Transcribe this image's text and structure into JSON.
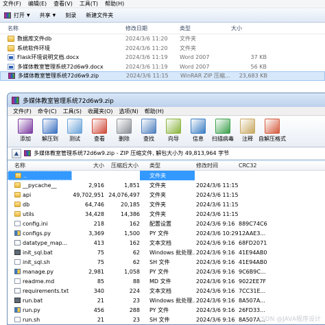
{
  "explorer": {
    "menu": [
      "文件(F)",
      "编辑(E)",
      "查看(V)",
      "工具(T)",
      "帮助(H)"
    ],
    "toolbar": {
      "open": "打开",
      "share": "共享",
      "burn": "刻录",
      "new_folder": "新建文件夹"
    },
    "columns": {
      "name": "名称",
      "date": "修改日期",
      "type": "类型",
      "size": "大小"
    },
    "rows": [
      {
        "name": "数据库文件db",
        "date": "2024/3/6 11:20",
        "type": "文件夹",
        "size": "",
        "icon": "folder-icon"
      },
      {
        "name": "系统软件环境",
        "date": "2024/3/6 11:20",
        "type": "文件夹",
        "size": "",
        "icon": "folder-icon"
      },
      {
        "name": "Flask环境说明文档.docx",
        "date": "2024/3/6 11:19",
        "type": "Word 2007",
        "size": "37 KB",
        "icon": "doc-icon"
      },
      {
        "name": "多媒体教室管理系统72d6w9.docx",
        "date": "2024/3/6 11:19",
        "type": "Word 2007",
        "size": "56 KB",
        "icon": "doc-icon"
      },
      {
        "name": "多媒体教室管理系统72d6w9.zip",
        "date": "2024/3/6 11:15",
        "type": "WinRAR ZIP 压缩...",
        "size": "23,683 KB",
        "icon": "zip-icon"
      }
    ]
  },
  "winrar": {
    "title": "多媒体教室管理系统72d6w9.zip",
    "menu": [
      "文件(F)",
      "命令(C)",
      "工具(S)",
      "收藏夹(O)",
      "选项(N)",
      "帮助(H)"
    ],
    "tools": [
      {
        "label": "添加",
        "icon": "add-icon",
        "color": "#7b3aa0"
      },
      {
        "label": "解压到",
        "icon": "extract-to-icon",
        "color": "#3a6fc1"
      },
      {
        "label": "测试",
        "icon": "test-icon",
        "color": "#6aa3d8"
      },
      {
        "label": "查看",
        "icon": "view-icon",
        "color": "#d04a3a"
      },
      {
        "label": "删除",
        "icon": "delete-icon",
        "color": "#8a8f96"
      },
      {
        "label": "查找",
        "icon": "find-icon",
        "color": "#4d7fbf"
      },
      {
        "label": "向导",
        "icon": "wizard-icon",
        "color": "#8ab43d"
      },
      {
        "label": "信息",
        "icon": "info-icon",
        "color": "#3a7cc3"
      },
      {
        "label": "扫描病毒",
        "icon": "virus-scan-icon",
        "color": "#3aa04a"
      },
      {
        "label": "注释",
        "icon": "comment-icon",
        "color": "#c8a860"
      },
      {
        "label": "自解压格式",
        "icon": "sfx-icon",
        "color": "#d45a3c"
      }
    ],
    "address": "多媒体教室管理系统72d6w9.zip - ZIP 压缩文件, 解包大小为 49,813,964 字节",
    "columns": {
      "name": "名称",
      "size": "大小",
      "packed": "压缩后大小",
      "type": "类型",
      "modified": "修改时间",
      "crc": "CRC32"
    },
    "rows": [
      {
        "name": "..",
        "size": "",
        "packed": "",
        "type": "文件夹",
        "modified": "",
        "crc": "",
        "icon": "folder-icon",
        "selected": true
      },
      {
        "name": "__pycache__",
        "size": "2,916",
        "packed": "1,851",
        "type": "文件夹",
        "modified": "2024/3/6 11:15",
        "crc": "",
        "icon": "folder-icon"
      },
      {
        "name": "api",
        "size": "49,702,951",
        "packed": "24,076,497",
        "type": "文件夹",
        "modified": "2024/3/6 11:15",
        "crc": "",
        "icon": "folder-icon"
      },
      {
        "name": "db",
        "size": "64,746",
        "packed": "20,185",
        "type": "文件夹",
        "modified": "2024/3/6 11:15",
        "crc": "",
        "icon": "folder-icon"
      },
      {
        "name": "utils",
        "size": "34,428",
        "packed": "14,386",
        "type": "文件夹",
        "modified": "2024/3/6 11:15",
        "crc": "",
        "icon": "folder-icon"
      },
      {
        "name": "config.ini",
        "size": "218",
        "packed": "162",
        "type": "配置设置",
        "modified": "2024/3/6 9:16",
        "crc": "889C74C6",
        "icon": "file-ico"
      },
      {
        "name": "configs.py",
        "size": "3,369",
        "packed": "1,500",
        "type": "PY 文件",
        "modified": "2024/3/6 10:29",
        "crc": "12AAE3...",
        "icon": "py-ico"
      },
      {
        "name": "datatype_map...",
        "size": "413",
        "packed": "162",
        "type": "文本文档",
        "modified": "2024/3/6 9:16",
        "crc": "68FD2071",
        "icon": "txt-ico"
      },
      {
        "name": "init_sql.bat",
        "size": "75",
        "packed": "62",
        "type": "Windows 批处理...",
        "modified": "2024/3/6 9:16",
        "crc": "41E94AB0",
        "icon": "bat-ico"
      },
      {
        "name": "init_sql.sh",
        "size": "75",
        "packed": "62",
        "type": "SH 文件",
        "modified": "2024/3/6 9:16",
        "crc": "41E94AB0",
        "icon": "file-ico"
      },
      {
        "name": "manage.py",
        "size": "2,981",
        "packed": "1,058",
        "type": "PY 文件",
        "modified": "2024/3/6 9:16",
        "crc": "9C6B9C...",
        "icon": "py-ico"
      },
      {
        "name": "readme.md",
        "size": "85",
        "packed": "88",
        "type": "MD 文件",
        "modified": "2024/3/6 9:16",
        "crc": "9022EE7F",
        "icon": "file-ico"
      },
      {
        "name": "requirements.txt",
        "size": "340",
        "packed": "224",
        "type": "文本文档",
        "modified": "2024/3/6 9:16",
        "crc": "7CC31E...",
        "icon": "txt-ico"
      },
      {
        "name": "run.bat",
        "size": "21",
        "packed": "23",
        "type": "Windows 批处理...",
        "modified": "2024/3/6 9:16",
        "crc": "8A507A...",
        "icon": "bat-ico"
      },
      {
        "name": "run.py",
        "size": "456",
        "packed": "288",
        "type": "PY 文件",
        "modified": "2024/3/6 9:16",
        "crc": "26FD33...",
        "icon": "py-ico"
      },
      {
        "name": "run.sh",
        "size": "21",
        "packed": "23",
        "type": "SH 文件",
        "modified": "2024/3/6 9:16",
        "crc": "8A507A...",
        "icon": "file-ico"
      }
    ]
  },
  "watermark": "CSDN @JAVA程序设计"
}
